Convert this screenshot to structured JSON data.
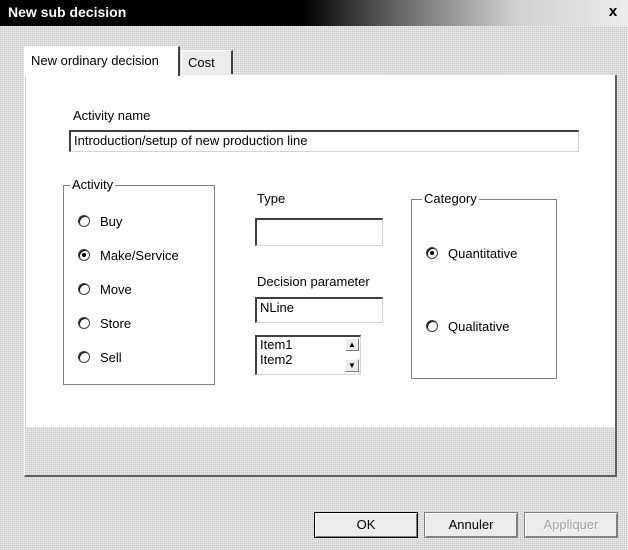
{
  "window": {
    "title": "New sub decision",
    "close_label": "x"
  },
  "tabs": [
    {
      "label": "New ordinary decision",
      "active": true
    },
    {
      "label": "Cost",
      "active": false
    }
  ],
  "activity_name": {
    "label": "Activity name",
    "value": "Introduction/setup of new production line"
  },
  "activity_group": {
    "title": "Activity",
    "options": [
      "Buy",
      "Make/Service",
      "Move",
      "Store",
      "Sell"
    ],
    "selected": "Make/Service"
  },
  "type": {
    "label": "Type",
    "value": ""
  },
  "decision_parameter": {
    "label": "Decision parameter",
    "value": "NLine",
    "items": [
      "Item1",
      "Item2"
    ]
  },
  "category_group": {
    "title": "Category",
    "options": [
      "Quantitative",
      "Qualitative"
    ],
    "selected": "Quantitative"
  },
  "buttons": {
    "ok": "OK",
    "cancel": "Annuler",
    "apply": "Appliquer"
  },
  "colors": {
    "titlebar": "#000000",
    "face": "#ececec",
    "panel": "#ffffff"
  }
}
